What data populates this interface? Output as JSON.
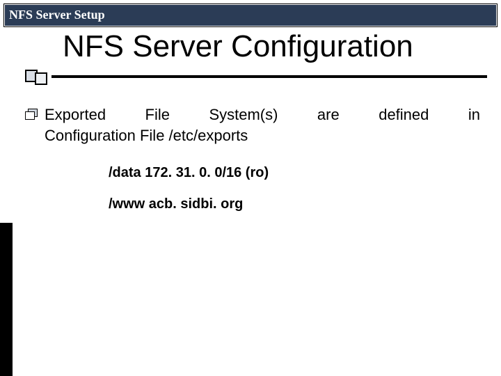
{
  "header": {
    "title": "NFS Server Setup"
  },
  "slide": {
    "title": "NFS Server Configuration",
    "bullet_line1": "Exported File System(s) are defined in",
    "bullet_line2": "Configuration File /etc/exports",
    "example1": "/data 172. 31. 0. 0/16 (ro)",
    "example2": "/www acb. sidbi. org"
  }
}
